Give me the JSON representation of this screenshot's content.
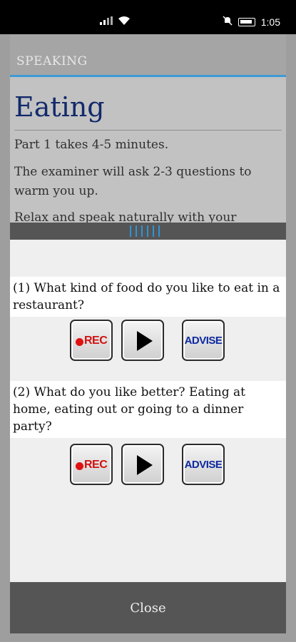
{
  "status_bar": {
    "time": "1:05"
  },
  "app_bar": {
    "title": "SPEAKING"
  },
  "content": {
    "heading": "Eating",
    "paragraphs": [
      "Part 1 takes 4-5 minutes.",
      "The examiner will ask 2-3 questions to warm you up.",
      "Relax and speak naturally with your"
    ]
  },
  "questions": [
    {
      "text": "(1) What kind of food do you like to eat in a restaurant?",
      "rec_label": "REC",
      "advise_label": "ADVISE"
    },
    {
      "text": "(2) What do you like better? Eating at home, eating out or going to a dinner party?",
      "rec_label": "REC",
      "advise_label": "ADVISE"
    }
  ],
  "footer": {
    "close_label": "Close"
  },
  "colors": {
    "heading": "#122a6b",
    "accent": "#3d9ad6",
    "rec": "#d21010",
    "advise": "#0d2aa0"
  }
}
